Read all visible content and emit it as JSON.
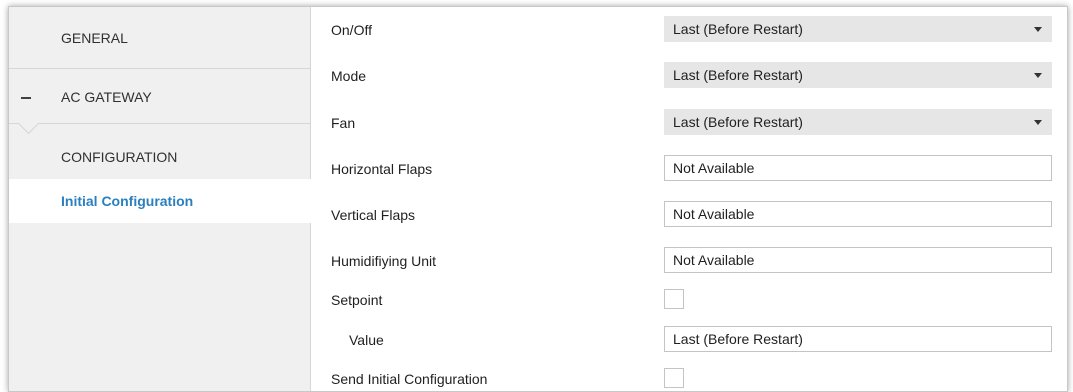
{
  "sidebar": {
    "general_label": "GENERAL",
    "ac_gateway_label": "AC GATEWAY",
    "configuration_label": "CONFIGURATION",
    "initial_configuration_label": "Initial Configuration",
    "active_color": "#2a7fbf"
  },
  "fields": {
    "on_off": {
      "label": "On/Off",
      "value": "Last (Before Restart)"
    },
    "mode": {
      "label": "Mode",
      "value": "Last (Before Restart)"
    },
    "fan": {
      "label": "Fan",
      "value": "Last (Before Restart)"
    },
    "horizontal_flaps": {
      "label": "Horizontal Flaps",
      "value": "Not Available"
    },
    "vertical_flaps": {
      "label": "Vertical Flaps",
      "value": "Not Available"
    },
    "humidifying_unit": {
      "label": "Humidifiying Unit",
      "value": "Not Available"
    },
    "setpoint": {
      "label": "Setpoint",
      "checked": false
    },
    "setpoint_value": {
      "label": "Value",
      "value": "Last (Before Restart)"
    },
    "send_initial_configuration": {
      "label": "Send Initial Configuration",
      "checked": false
    }
  },
  "icons": {
    "collapse": "minus-icon",
    "dropdown": "chevron-down-icon"
  }
}
